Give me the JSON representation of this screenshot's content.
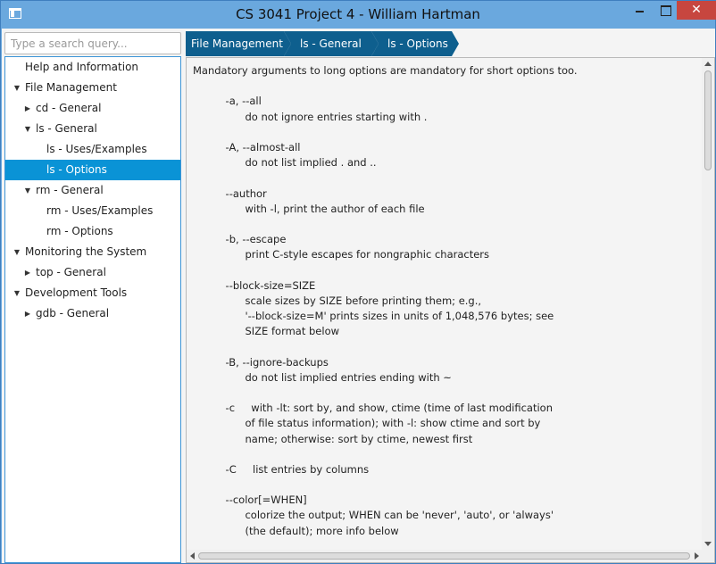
{
  "window": {
    "title": "CS 3041 Project 4 - William Hartman",
    "close_glyph": "✕"
  },
  "search": {
    "placeholder": "Type a search query..."
  },
  "tree": {
    "items": [
      {
        "label": "Help and Information",
        "expanded": null,
        "selected": false
      },
      {
        "label": "File Management",
        "expanded": true,
        "selected": false
      },
      {
        "label": "cd - General",
        "expanded": false,
        "selected": false
      },
      {
        "label": "ls - General",
        "expanded": true,
        "selected": false
      },
      {
        "label": "ls - Uses/Examples",
        "expanded": null,
        "selected": false
      },
      {
        "label": "ls - Options",
        "expanded": null,
        "selected": true
      },
      {
        "label": "rm - General",
        "expanded": true,
        "selected": false
      },
      {
        "label": "rm - Uses/Examples",
        "expanded": null,
        "selected": false
      },
      {
        "label": "rm - Options",
        "expanded": null,
        "selected": false
      },
      {
        "label": "Monitoring the System",
        "expanded": true,
        "selected": false
      },
      {
        "label": "top - General",
        "expanded": false,
        "selected": false
      },
      {
        "label": "Development Tools",
        "expanded": true,
        "selected": false
      },
      {
        "label": "gdb - General",
        "expanded": false,
        "selected": false
      }
    ],
    "arrow_expanded": "▼",
    "arrow_collapsed": "▶"
  },
  "breadcrumb": [
    "File Management",
    "ls - General",
    "ls - Options"
  ],
  "colors": {
    "accent": "#0a93d6",
    "breadcrumb": "#0e5f8e",
    "titlebar": "#6aa8de",
    "close": "#c7463f"
  },
  "content": {
    "lines": [
      "Mandatory arguments to long options are mandatory for short options too.",
      "",
      "          -a, --all",
      "                do not ignore entries starting with .",
      "",
      "          -A, --almost-all",
      "                do not list implied . and ..",
      "",
      "          --author",
      "                with -l, print the author of each file",
      "",
      "          -b, --escape",
      "                print C-style escapes for nongraphic characters",
      "",
      "          --block-size=SIZE",
      "                scale sizes by SIZE before printing them; e.g.,",
      "                '--block-size=M' prints sizes in units of 1,048,576 bytes; see",
      "                SIZE format below",
      "",
      "          -B, --ignore-backups",
      "                do not list implied entries ending with ~",
      "",
      "          -c     with -lt: sort by, and show, ctime (time of last modification",
      "                of file status information); with -l: show ctime and sort by",
      "                name; otherwise: sort by ctime, newest first",
      "",
      "          -C     list entries by columns",
      "",
      "          --color[=WHEN]",
      "                colorize the output; WHEN can be 'never', 'auto', or 'always'",
      "                (the default); more info below"
    ]
  }
}
